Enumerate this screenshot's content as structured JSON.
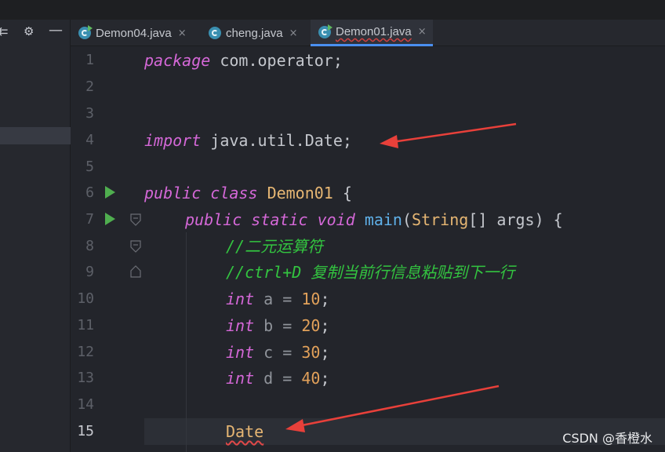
{
  "tabs": [
    {
      "label": "Demon04.java",
      "active": false
    },
    {
      "label": "cheng.java",
      "active": false
    },
    {
      "label": "Demon01.java",
      "active": true
    }
  ],
  "icons": {
    "sidebar_left": "collapse-icon",
    "sidebar_gear": "gear-icon",
    "sidebar_minimize": "minimize-icon",
    "tab_close": "×"
  },
  "line_numbers": [
    "1",
    "2",
    "3",
    "4",
    "5",
    "6",
    "7",
    "8",
    "9",
    "10",
    "11",
    "12",
    "13",
    "14",
    "15"
  ],
  "code": {
    "l1": {
      "kw": "package",
      "rest": " com.operator;"
    },
    "l4": {
      "kw": "import",
      "rest": " java.util.Date;"
    },
    "l6": {
      "kw1": "public",
      "kw2": "class",
      "cls": "Demon01",
      "rest": " {"
    },
    "l7": {
      "kw1": "public",
      "kw2": "static",
      "kw3": "void",
      "fn": "main",
      "p1": "(",
      "cls": "String",
      "p2": "[] args) {"
    },
    "l8": {
      "comment": "//二元运算符"
    },
    "l9": {
      "comment": "//ctrl+D 复制当前行信息粘贴到下一行"
    },
    "l10": {
      "kw": "int",
      "var": " a = ",
      "num": "10",
      "end": ";"
    },
    "l11": {
      "kw": "int",
      "var": " b = ",
      "num": "20",
      "end": ";"
    },
    "l12": {
      "kw": "int",
      "var": " c = ",
      "num": "30",
      "end": ";"
    },
    "l13": {
      "kw": "int",
      "var": " d = ",
      "num": "40",
      "end": ";"
    },
    "l15": {
      "cls": "Date"
    }
  },
  "watermark": "CSDN @香橙水",
  "colors": {
    "background": "#23252b",
    "keyword": "#d568d8",
    "class": "#e6b673",
    "function": "#5fb0e8",
    "number": "#e2a15a",
    "comment": "#33c440",
    "annotation_arrow": "#e8403a",
    "active_tab_underline": "#4a8ff0"
  }
}
